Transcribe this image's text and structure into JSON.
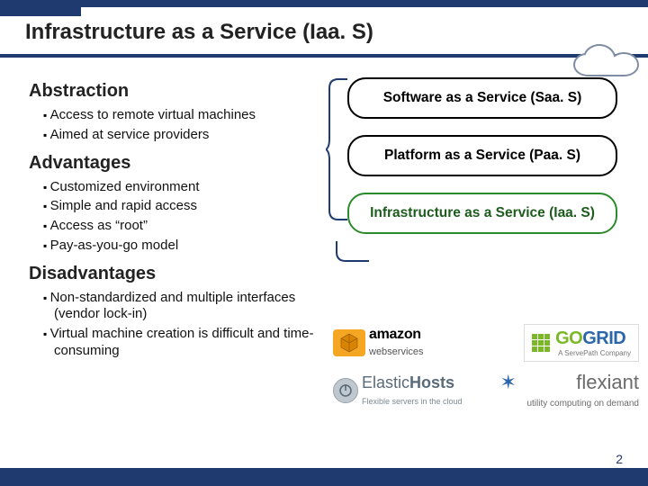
{
  "title": "Infrastructure as a Service (Iaa. S)",
  "sections": {
    "abstraction": {
      "heading": "Abstraction",
      "items": [
        "Access to remote virtual machines",
        "Aimed at service providers"
      ]
    },
    "advantages": {
      "heading": "Advantages",
      "items": [
        "Customized environment",
        "Simple and rapid access",
        "Access as “root”",
        "Pay-as-you-go model"
      ]
    },
    "disadvantages": {
      "heading": "Disadvantages",
      "items": [
        "Non-standardized and multiple interfaces (vendor lock-in)",
        "Virtual machine creation is difficult and time-consuming"
      ]
    }
  },
  "layers": {
    "saas": "Software as a Service (Saa. S)",
    "paas": "Platform as a Service (Paa. S)",
    "iaas": "Infrastructure as a Service (Iaa. S)"
  },
  "logos": {
    "amazon": {
      "name": "amazon",
      "sub": "webservices"
    },
    "gogrid": {
      "p1": "GO",
      "p2": "GRID",
      "tag": "A ServePath Company"
    },
    "elastichosts": {
      "p1": "Elastic",
      "p2": "Hosts",
      "tag": "Flexible servers in the cloud"
    },
    "flexiant": {
      "name": "flexiant",
      "tag": "utility computing on demand"
    }
  },
  "page": "2",
  "colors": {
    "brand": "#1e3a6e",
    "highlight": "#2b8a2b"
  }
}
